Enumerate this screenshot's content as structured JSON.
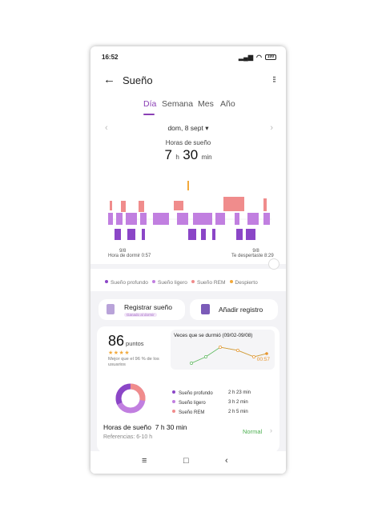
{
  "status_bar": {
    "time": "16:52",
    "battery": "100"
  },
  "header": {
    "title": "Sueño"
  },
  "tabs": [
    {
      "label": "Día",
      "active": true
    },
    {
      "label": "Semana",
      "active": false
    },
    {
      "label": "Mes",
      "active": false
    },
    {
      "label": "Año",
      "active": false
    }
  ],
  "date": {
    "label": "dom, 8 sept"
  },
  "summary_top": {
    "label": "Horas de sueño",
    "hours": "7",
    "h_unit": "h",
    "minutes": "30",
    "min_unit": "min"
  },
  "chart_info": {
    "left_date": "9/8",
    "left_label": "Hora de dormir 0:57",
    "right_date": "9/8",
    "right_label": "Te despertaste 8:29"
  },
  "legend": [
    "Sueño profundo",
    "Sueño ligero",
    "Sueño REM",
    "Despierto"
  ],
  "actions": {
    "register_sleep": "Registrar sueño",
    "register_sub": "Ganado al dormir",
    "add_record": "Añadir registro"
  },
  "score": {
    "value": "86",
    "unit": "puntos",
    "stars": "★★★★",
    "note": "Mejor que el 96 % de los usuarios"
  },
  "mini_chart": {
    "title": "Veces que se durmió (09/02-09/08)",
    "latest": "00:57"
  },
  "breakdown": [
    {
      "label": "Sueño profundo",
      "value": "2 h 23 min"
    },
    {
      "label": "Sueño ligero",
      "value": "3 h 2 min"
    },
    {
      "label": "Sueño REM",
      "value": "2 h 5 min"
    }
  ],
  "bottom_summary": {
    "title_label": "Horas de sueño",
    "title_value": "7 h 30 min",
    "ref": "Referencias: 6-10 h",
    "status": "Normal"
  },
  "colors": {
    "accent": "#8a3fb5",
    "deep": "#8b46c7",
    "light": "#c17fe0",
    "rem": "#f08c8c",
    "awake": "#f2a93b"
  }
}
